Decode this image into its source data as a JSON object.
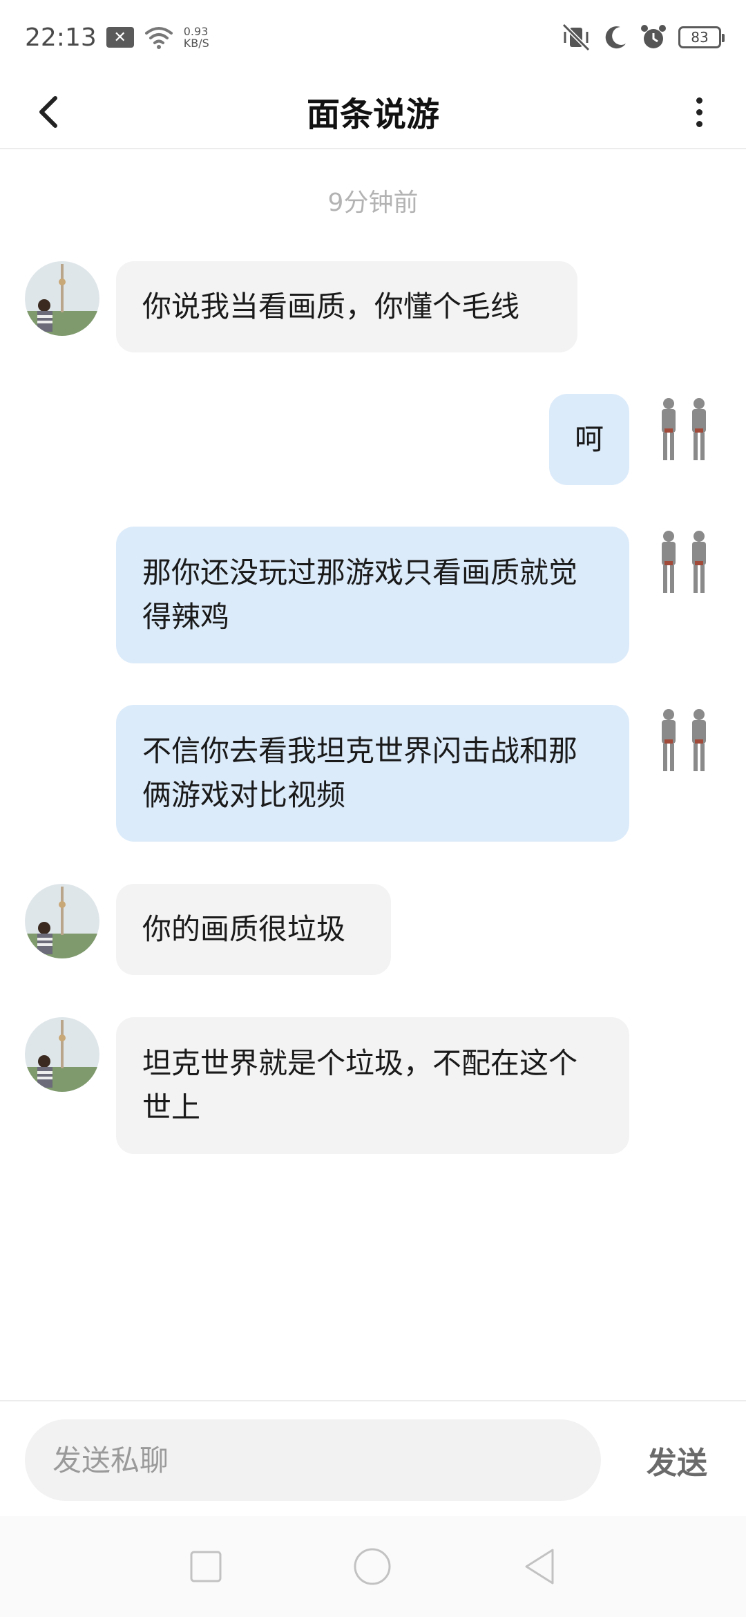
{
  "status_bar": {
    "time": "22:13",
    "net_speed_value": "0.93",
    "net_speed_unit": "KB/S",
    "battery": "83"
  },
  "header": {
    "title": "面条说游"
  },
  "chat": {
    "timestamp": "9分钟前",
    "messages": [
      {
        "direction": "in",
        "text": "你说我当看画质，你懂个毛线"
      },
      {
        "direction": "out",
        "text": "呵"
      },
      {
        "direction": "out",
        "text": "那你还没玩过那游戏只看画质就觉得辣鸡"
      },
      {
        "direction": "out",
        "text": "不信你去看我坦克世界闪击战和那俩游戏对比视频"
      },
      {
        "direction": "in",
        "text": "你的画质很垃圾"
      },
      {
        "direction": "in",
        "text": "坦克世界就是个垃圾，不配在这个世上"
      }
    ]
  },
  "composer": {
    "placeholder": "发送私聊",
    "send_label": "发送"
  },
  "colors": {
    "incoming_bubble": "#f3f3f3",
    "outgoing_bubble": "#dcebfa"
  }
}
